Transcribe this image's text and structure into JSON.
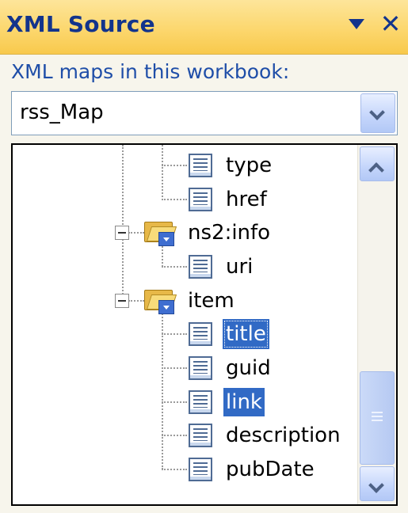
{
  "pane": {
    "title": "XML Source",
    "close_glyph": "✕"
  },
  "maps": {
    "label": "XML maps in this workbook:",
    "selected_map": "rss_Map"
  },
  "tree": {
    "nodes": [
      {
        "label": "type",
        "kind": "element",
        "selected": false
      },
      {
        "label": "href",
        "kind": "element",
        "selected": false
      },
      {
        "label": "ns2:info",
        "kind": "folder",
        "expanded": true
      },
      {
        "label": "uri",
        "kind": "element",
        "selected": false
      },
      {
        "label": "item",
        "kind": "folder",
        "expanded": true
      },
      {
        "label": "title",
        "kind": "element",
        "selected": true,
        "focused": true
      },
      {
        "label": "guid",
        "kind": "element",
        "selected": false
      },
      {
        "label": "link",
        "kind": "element",
        "selected": true
      },
      {
        "label": "description",
        "kind": "element",
        "selected": false
      },
      {
        "label": "pubDate",
        "kind": "element",
        "selected": false
      }
    ]
  },
  "icons": {
    "element": "document-lines-icon",
    "folder": "folder-repeating-icon",
    "collapse": "minus-box-icon"
  },
  "colors": {
    "title_bar": "#fcd76e",
    "title_text": "#13348c",
    "selection": "#316ac5"
  }
}
